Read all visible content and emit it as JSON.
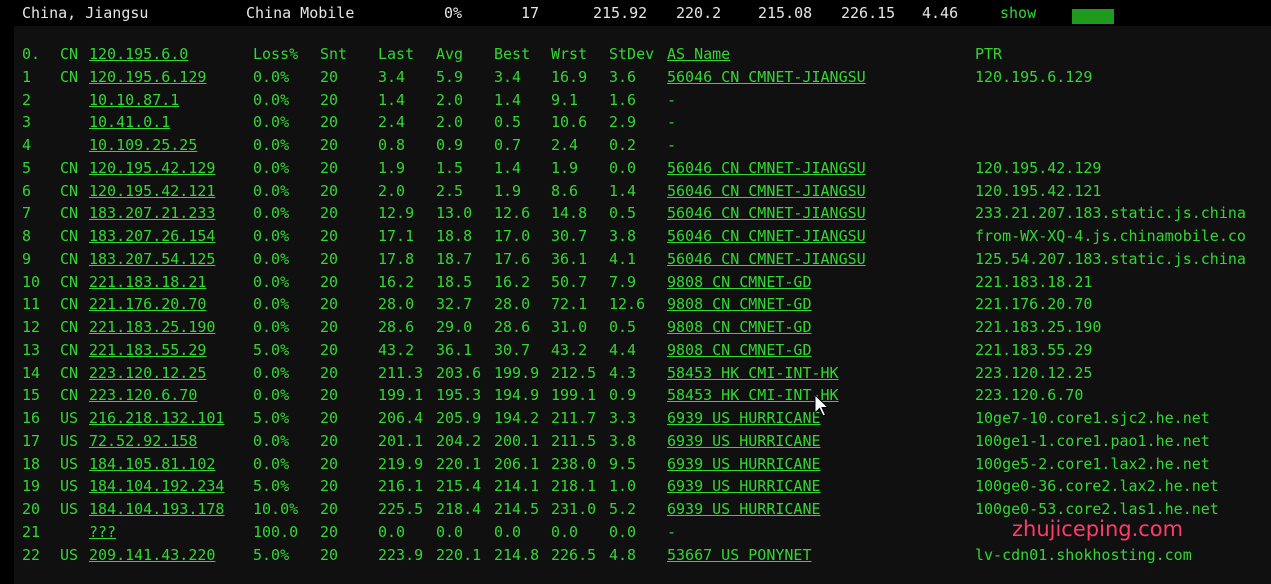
{
  "header": {
    "location": "China, Jiangsu",
    "isp": "China Mobile",
    "loss": "0%",
    "sent": "17",
    "v1": "215.92",
    "v2": "220.2",
    "v3": "215.08",
    "v4": "226.15",
    "v5": "4.46",
    "show_label": "show",
    "accent": "#33d633"
  },
  "table": {
    "columns": {
      "hop": "0.",
      "cc": "CN",
      "ip": "120.195.6.0",
      "loss": "Loss%",
      "snt": "Snt",
      "last": "Last",
      "avg": "Avg",
      "best": "Best",
      "wrst": "Wrst",
      "stdev": "StDev",
      "asname": "AS Name",
      "ptr": "PTR"
    },
    "rows": [
      {
        "hop": "1",
        "cc": "CN",
        "ip": "120.195.6.129",
        "loss": "0.0%",
        "snt": "20",
        "last": "3.4",
        "avg": "5.9",
        "best": "3.4",
        "wrst": "16.9",
        "stdev": "3.6",
        "asname": "56046 CN CMNET-JIANGSU",
        "ptr": "120.195.6.129"
      },
      {
        "hop": "2",
        "cc": "",
        "ip": "10.10.87.1",
        "loss": "0.0%",
        "snt": "20",
        "last": "1.4",
        "avg": "2.0",
        "best": "1.4",
        "wrst": "9.1",
        "stdev": "1.6",
        "asname": "-",
        "ptr": ""
      },
      {
        "hop": "3",
        "cc": "",
        "ip": "10.41.0.1",
        "loss": "0.0%",
        "snt": "20",
        "last": "2.4",
        "avg": "2.0",
        "best": "0.5",
        "wrst": "10.6",
        "stdev": "2.9",
        "asname": "-",
        "ptr": ""
      },
      {
        "hop": "4",
        "cc": "",
        "ip": "10.109.25.25",
        "loss": "0.0%",
        "snt": "20",
        "last": "0.8",
        "avg": "0.9",
        "best": "0.7",
        "wrst": "2.4",
        "stdev": "0.2",
        "asname": "-",
        "ptr": ""
      },
      {
        "hop": "5",
        "cc": "CN",
        "ip": "120.195.42.129",
        "loss": "0.0%",
        "snt": "20",
        "last": "1.9",
        "avg": "1.5",
        "best": "1.4",
        "wrst": "1.9",
        "stdev": "0.0",
        "asname": "56046 CN CMNET-JIANGSU",
        "ptr": "120.195.42.129"
      },
      {
        "hop": "6",
        "cc": "CN",
        "ip": "120.195.42.121",
        "loss": "0.0%",
        "snt": "20",
        "last": "2.0",
        "avg": "2.5",
        "best": "1.9",
        "wrst": "8.6",
        "stdev": "1.4",
        "asname": "56046 CN CMNET-JIANGSU",
        "ptr": "120.195.42.121"
      },
      {
        "hop": "7",
        "cc": "CN",
        "ip": "183.207.21.233",
        "loss": "0.0%",
        "snt": "20",
        "last": "12.9",
        "avg": "13.0",
        "best": "12.6",
        "wrst": "14.8",
        "stdev": "0.5",
        "asname": "56046 CN CMNET-JIANGSU",
        "ptr": "233.21.207.183.static.js.china"
      },
      {
        "hop": "8",
        "cc": "CN",
        "ip": "183.207.26.154",
        "loss": "0.0%",
        "snt": "20",
        "last": "17.1",
        "avg": "18.8",
        "best": "17.0",
        "wrst": "30.7",
        "stdev": "3.8",
        "asname": "56046 CN CMNET-JIANGSU",
        "ptr": "from-WX-XQ-4.js.chinamobile.co"
      },
      {
        "hop": "9",
        "cc": "CN",
        "ip": "183.207.54.125",
        "loss": "0.0%",
        "snt": "20",
        "last": "17.8",
        "avg": "18.7",
        "best": "17.6",
        "wrst": "36.1",
        "stdev": "4.1",
        "asname": "56046 CN CMNET-JIANGSU",
        "ptr": "125.54.207.183.static.js.china"
      },
      {
        "hop": "10",
        "cc": "CN",
        "ip": "221.183.18.21",
        "loss": "0.0%",
        "snt": "20",
        "last": "16.2",
        "avg": "18.5",
        "best": "16.2",
        "wrst": "50.7",
        "stdev": "7.9",
        "asname": "9808  CN CMNET-GD",
        "ptr": "221.183.18.21"
      },
      {
        "hop": "11",
        "cc": "CN",
        "ip": "221.176.20.70",
        "loss": "0.0%",
        "snt": "20",
        "last": "28.0",
        "avg": "32.7",
        "best": "28.0",
        "wrst": "72.1",
        "stdev": "12.6",
        "asname": "9808  CN CMNET-GD",
        "ptr": "221.176.20.70"
      },
      {
        "hop": "12",
        "cc": "CN",
        "ip": "221.183.25.190",
        "loss": "0.0%",
        "snt": "20",
        "last": "28.6",
        "avg": "29.0",
        "best": "28.6",
        "wrst": "31.0",
        "stdev": "0.5",
        "asname": "9808  CN CMNET-GD",
        "ptr": "221.183.25.190"
      },
      {
        "hop": "13",
        "cc": "CN",
        "ip": "221.183.55.29",
        "loss": "5.0%",
        "snt": "20",
        "last": "43.2",
        "avg": "36.1",
        "best": "30.7",
        "wrst": "43.2",
        "stdev": "4.4",
        "asname": "9808  CN CMNET-GD",
        "ptr": "221.183.55.29"
      },
      {
        "hop": "14",
        "cc": "CN",
        "ip": "223.120.12.25",
        "loss": "0.0%",
        "snt": "20",
        "last": "211.3",
        "avg": "203.6",
        "best": "199.9",
        "wrst": "212.5",
        "stdev": "4.3",
        "asname": "58453 HK CMI-INT-HK",
        "ptr": "223.120.12.25"
      },
      {
        "hop": "15",
        "cc": "CN",
        "ip": "223.120.6.70",
        "loss": "0.0%",
        "snt": "20",
        "last": "199.1",
        "avg": "195.3",
        "best": "194.9",
        "wrst": "199.1",
        "stdev": "0.9",
        "asname": "58453 HK CMI-INT-HK",
        "ptr": "223.120.6.70"
      },
      {
        "hop": "16",
        "cc": "US",
        "ip": "216.218.132.101",
        "loss": "5.0%",
        "snt": "20",
        "last": "206.4",
        "avg": "205.9",
        "best": "194.2",
        "wrst": "211.7",
        "stdev": "3.3",
        "asname": "6939  US HURRICANE",
        "ptr": "10ge7-10.core1.sjc2.he.net"
      },
      {
        "hop": "17",
        "cc": "US",
        "ip": "72.52.92.158",
        "loss": "0.0%",
        "snt": "20",
        "last": "201.1",
        "avg": "204.2",
        "best": "200.1",
        "wrst": "211.5",
        "stdev": "3.8",
        "asname": "6939  US HURRICANE",
        "ptr": "100ge1-1.core1.pao1.he.net"
      },
      {
        "hop": "18",
        "cc": "US",
        "ip": "184.105.81.102",
        "loss": "0.0%",
        "snt": "20",
        "last": "219.9",
        "avg": "220.1",
        "best": "206.1",
        "wrst": "238.0",
        "stdev": "9.5",
        "asname": "6939  US HURRICANE",
        "ptr": "100ge5-2.core1.lax2.he.net"
      },
      {
        "hop": "19",
        "cc": "US",
        "ip": "184.104.192.234",
        "loss": "5.0%",
        "snt": "20",
        "last": "216.1",
        "avg": "215.4",
        "best": "214.1",
        "wrst": "218.1",
        "stdev": "1.0",
        "asname": "6939  US HURRICANE",
        "ptr": "100ge0-36.core2.lax2.he.net"
      },
      {
        "hop": "20",
        "cc": "US",
        "ip": "184.104.193.178",
        "loss": "10.0%",
        "snt": "20",
        "last": "225.5",
        "avg": "218.4",
        "best": "214.5",
        "wrst": "231.0",
        "stdev": "5.2",
        "asname": "6939  US HURRICANE",
        "ptr": "100ge0-53.core2.las1.he.net"
      },
      {
        "hop": "21",
        "cc": "",
        "ip": "???",
        "loss": "100.0",
        "snt": "20",
        "last": "0.0",
        "avg": "0.0",
        "best": "0.0",
        "wrst": "0.0",
        "stdev": "0.0",
        "asname": "-",
        "ptr": ""
      },
      {
        "hop": "22",
        "cc": "US",
        "ip": "209.141.43.220",
        "loss": "5.0%",
        "snt": "20",
        "last": "223.9",
        "avg": "220.1",
        "best": "214.8",
        "wrst": "226.5",
        "stdev": "4.8",
        "asname": "53667 US PONYNET",
        "ptr": "lv-cdn01.shokhosting.com"
      }
    ]
  },
  "watermark": "zhujiceping.com",
  "cursor_icon": "mouse-pointer-icon"
}
